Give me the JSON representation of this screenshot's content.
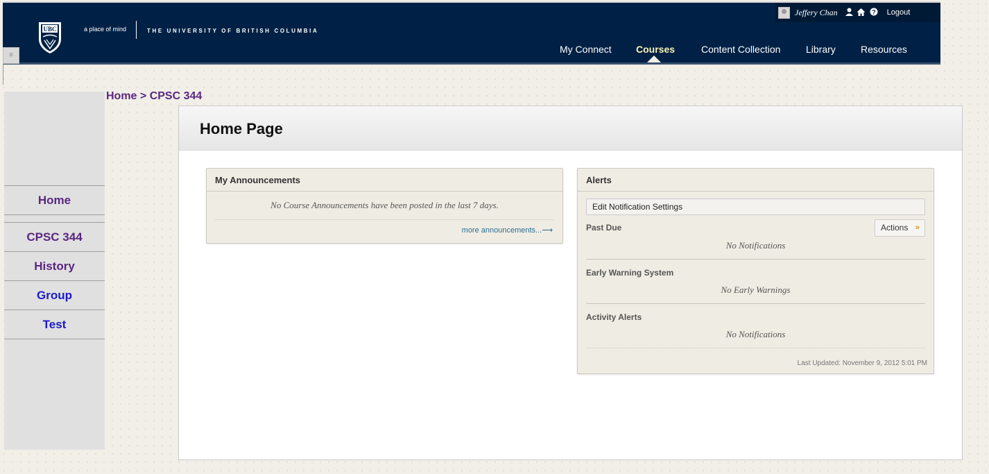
{
  "header": {
    "logo_text": "UBC",
    "tagline": "a place of mind",
    "university": "THE UNIVERSITY OF BRITISH COLUMBIA",
    "user_name": "Jeffery Chan",
    "logout": "Logout",
    "nav": [
      "My Connect",
      "Courses",
      "Content Collection",
      "Library",
      "Resources"
    ],
    "active_nav": "Courses"
  },
  "breadcrumb": {
    "home": "Home",
    "separator": " > ",
    "course": "CPSC 344"
  },
  "sidebar": {
    "items": [
      {
        "label": "Home",
        "color": "#5a2680"
      },
      {
        "label": "CPSC 344",
        "color": "#5a2680"
      },
      {
        "label": "History",
        "color": "#5a2680"
      },
      {
        "label": "Group",
        "color": "#1a1acd"
      },
      {
        "label": "Test",
        "color": "#1a1acd"
      }
    ]
  },
  "main": {
    "title": "Home Page",
    "announcements": {
      "title": "My Announcements",
      "message": "No Course Announcements have been posted in the last 7 days.",
      "more_link": "more announcements...⟶"
    },
    "alerts": {
      "title": "Alerts",
      "edit_button": "Edit Notification Settings",
      "actions_button": "Actions",
      "sections": [
        {
          "title": "Past Due",
          "message": "No Notifications"
        },
        {
          "title": "Early Warning System",
          "message": "No Early Warnings"
        },
        {
          "title": "Activity Alerts",
          "message": "No Notifications"
        }
      ],
      "last_updated": "Last Updated: November 9, 2012 5:01 PM"
    }
  },
  "icons": {
    "profile": "person-icon",
    "home": "home-icon",
    "help": "help-icon"
  },
  "colors": {
    "header_bg": "#002145",
    "active_nav": "#fdf2b3",
    "link_purple": "#5a2680",
    "link_blue": "#1a1acd"
  }
}
